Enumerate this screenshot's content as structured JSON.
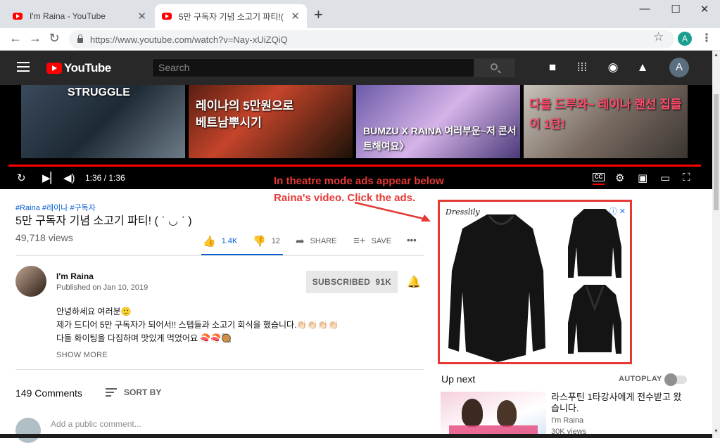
{
  "browser": {
    "tabs": [
      {
        "title": "I'm Raina - YouTube",
        "active": false
      },
      {
        "title": "5만 구독자 기념 소고기 파티!( ˈ ◡ ˈ ) - YouTube",
        "active": true
      }
    ],
    "new_tab": "+",
    "url": "https://www.youtube.com/watch?v=Nay-xUiZQiQ",
    "profile_initial": "A",
    "window_controls": [
      "—",
      "☐",
      "✕"
    ]
  },
  "masthead": {
    "logo_text": "YouTube",
    "search_placeholder": "Search",
    "avatar_initial": "A"
  },
  "player": {
    "time": "1:36 / 1:36",
    "progress_fraction": 1.0,
    "cc_label": "CC",
    "thumbnails": [
      {
        "caption": "STRUGGLE"
      },
      {
        "caption": "레이나의 5만원으로 베트남뿌시기"
      },
      {
        "caption": "BUMZU X RAINA 여러부운~저 콘서트해여요〉"
      },
      {
        "caption": "다들 드루와~ 레이나 랜선 집들이 1탄!"
      }
    ]
  },
  "annotation": {
    "text": "In theatre mode ads appear below Raina's video. Click the ads.",
    "color": "#e53935"
  },
  "video": {
    "hashtags": "#Raina #레이나 #구독자",
    "title": "5만 구독자 기념 소고기 파티! ( ˈ ◡ ˈ )",
    "views": "49,718 views",
    "likes": "1.4K",
    "dislikes": "12",
    "like_ratio": 0.99,
    "share_label": "SHARE",
    "save_label": "SAVE",
    "more_label": "•••"
  },
  "channel": {
    "name": "I'm Raina",
    "published": "Published on Jan 10, 2019",
    "subscribe_label": "SUBSCRIBED",
    "subscriber_count": "91K"
  },
  "description": {
    "lines": [
      "안녕하세요 여러분🙂",
      "제가 드디어 5만 구독자가 되어서!! 스텝들과 소고기 회식을 했습니다.👏🏻👏🏻👏🏻👏🏻",
      "다들 화이팅을 다짐하며 맛있게 먹었어요 🍣🍣🥘"
    ],
    "show_more": "SHOW MORE"
  },
  "comments": {
    "count": "149 Comments",
    "sort_label": "SORT BY",
    "input_placeholder": "Add a public comment..."
  },
  "ad": {
    "brand": "Dresslily"
  },
  "up_next": {
    "heading": "Up next",
    "autoplay_label": "AUTOPLAY",
    "autoplay_on": false,
    "items": [
      {
        "title": "라스푸틴 1타강사에게 전수받고 왔습니다.",
        "channel": "I'm Raina",
        "views": "30K views"
      }
    ]
  },
  "colors": {
    "accent_blue": "#065fd4",
    "youtube_red": "#ff0000",
    "masthead": "#282828"
  }
}
